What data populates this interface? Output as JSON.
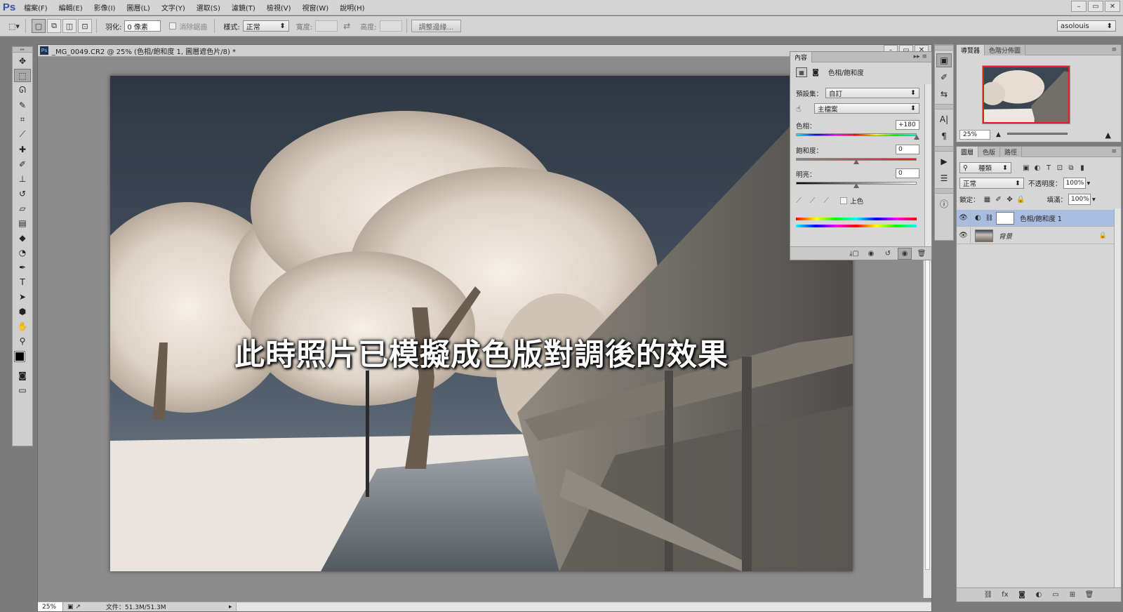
{
  "app": {
    "logo": "Ps"
  },
  "menu": [
    "檔案(F)",
    "編輯(E)",
    "影像(I)",
    "圖層(L)",
    "文字(Y)",
    "選取(S)",
    "濾鏡(T)",
    "檢視(V)",
    "視窗(W)",
    "說明(H)"
  ],
  "window_controls": {
    "minimize": "–",
    "restore": "▭",
    "close": "✕"
  },
  "options": {
    "feather_label": "羽化:",
    "feather_value": "0 像素",
    "antialias_label": "消除鋸齒",
    "style_label": "樣式:",
    "style_value": "正常",
    "width_label": "寬度:",
    "height_label": "高度:",
    "refine_edge_button": "調整邊緣...",
    "swap_icon": "⇄",
    "workspace": "asolouis"
  },
  "document": {
    "title": "_MG_0049.CR2 @ 25% (色相/飽和度 1, 圖層遮色片/8) *",
    "caption": "此時照片已模擬成色版對調後的效果",
    "zoom": "25%",
    "file_info": "文件：51.3M/51.3M"
  },
  "properties": {
    "tab": "內容",
    "adjustment_title": "色相/飽和度",
    "preset_label": "預設集：",
    "preset_value": "自訂",
    "channel_value": "主檔案",
    "hue_label": "色相：",
    "hue_value": "+180",
    "saturation_label": "飽和度：",
    "saturation_value": "0",
    "lightness_label": "明亮：",
    "lightness_value": "0",
    "colorize_label": "上色",
    "hue_level": 1.0,
    "saturation_level": 0.5,
    "lightness_level": 0.5
  },
  "navigator": {
    "tabs": [
      "導覽器",
      "色階分佈圖"
    ],
    "zoom": "25%"
  },
  "layers": {
    "tabs": [
      "圖層",
      "色版",
      "路徑"
    ],
    "filter_value": "種類",
    "blend_mode": "正常",
    "opacity_label": "不透明度：",
    "opacity_value": "100%",
    "lock_label": "鎖定：",
    "fill_label": "填滿：",
    "fill_value": "100%",
    "items": [
      {
        "name": "色相/飽和度 1"
      },
      {
        "name": "背景"
      }
    ]
  },
  "colors": {
    "selected_layer": "#a9bde0",
    "panel_bg": "#d6d6d6",
    "workspace_bg": "#7b7b7b"
  }
}
